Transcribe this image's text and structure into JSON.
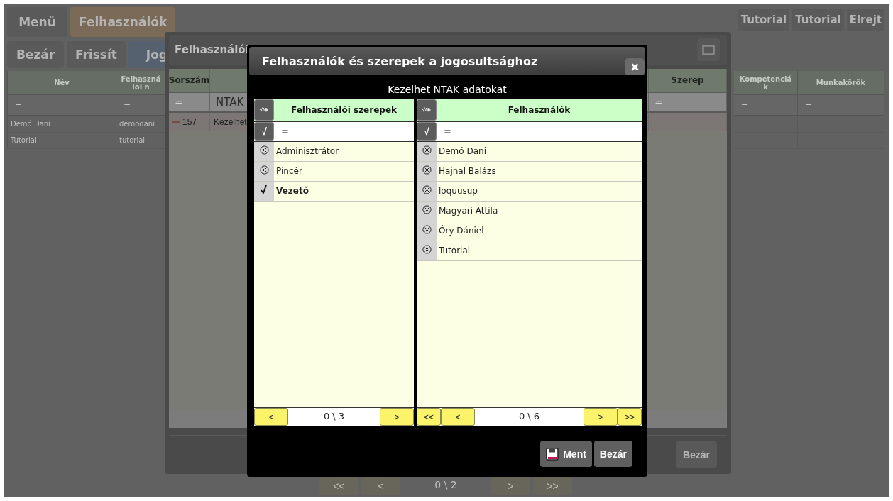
{
  "app": {
    "menu_button": "Menü",
    "current_tab": "Felhasználók",
    "user_buttons": [
      "Tutorial",
      "Tutorial",
      "Elrejt"
    ],
    "toolbar": [
      {
        "label": "Bezár",
        "kind": "plain"
      },
      {
        "label": "Frissít",
        "kind": "plain"
      },
      {
        "label": "Jog",
        "kind": "accent"
      }
    ],
    "table": {
      "columns": [
        {
          "heading": "Név",
          "filter": "=",
          "cells": [
            "Demó Dani",
            "Tutorial"
          ]
        },
        {
          "heading": "Felhasználói n",
          "filter": "=",
          "cells": [
            "demodani",
            "tutorial"
          ]
        },
        {
          "heading": "Kompetenciák",
          "filter": "="
        },
        {
          "heading": "Munkakörök",
          "filter": "="
        }
      ]
    },
    "pager": {
      "before": [
        "<<",
        "<"
      ],
      "position": "0 \\ 2",
      "after": [
        ">",
        ">>"
      ]
    }
  },
  "rights_dialog": {
    "title": "Felhasználói",
    "columns": [
      {
        "heading": "Sorszám",
        "filter": "=",
        "cell": "157"
      },
      {
        "filter": "NTAK",
        "cell": "Kezelhet"
      },
      {
        "heading": "Szerep",
        "filter": "="
      }
    ],
    "close_button": "Bezár"
  },
  "modal": {
    "title": "Felhasználók és szerepek a jogosultsághoz",
    "subtitle": "Kezelhet NTAK adatokat",
    "panels": [
      {
        "heading": "Felhasználói szerepek",
        "header_toggle": "√/⊗",
        "filter_toggle": "√",
        "filter": "=",
        "items": [
          {
            "label": "Adminisztrátor",
            "checked": false
          },
          {
            "label": "Pincér",
            "checked": false
          },
          {
            "label": "Vezető",
            "checked": true
          }
        ],
        "pager": {
          "before": [
            "<"
          ],
          "position": "0 \\ 3",
          "after": [
            ">"
          ]
        }
      },
      {
        "heading": "Felhasználók",
        "header_toggle": "√/⊗",
        "filter_toggle": "√",
        "filter": "=",
        "items": [
          {
            "label": "Demó Dani",
            "checked": false
          },
          {
            "label": "Hajnal Balázs",
            "checked": false
          },
          {
            "label": "loquusup",
            "checked": false
          },
          {
            "label": "Magyari Attila",
            "checked": false
          },
          {
            "label": "Óry Dániel",
            "checked": false
          },
          {
            "label": "Tutorial",
            "checked": false
          }
        ],
        "pager": {
          "before": [
            "<<",
            "<"
          ],
          "position": "0 \\ 6",
          "after": [
            ">",
            ">>"
          ]
        }
      }
    ],
    "buttons": [
      {
        "label": "Ment",
        "kind": "save"
      },
      {
        "label": "Bezár",
        "kind": "plain"
      }
    ]
  }
}
